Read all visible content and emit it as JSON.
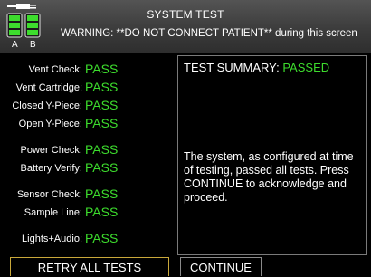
{
  "header": {
    "title": "SYSTEM TEST",
    "warning": "WARNING: **DO NOT CONNECT PATIENT** during this screen",
    "battery_a_label": "A",
    "battery_b_label": "B"
  },
  "checks": [
    {
      "label": "Vent Check:",
      "status": "PASS"
    },
    {
      "label": "Vent Cartridge:",
      "status": "PASS"
    },
    {
      "label": "Closed Y-Piece:",
      "status": "PASS"
    },
    {
      "label": "Open Y-Piece:",
      "status": "PASS"
    },
    {
      "label": "Power Check:",
      "status": "PASS"
    },
    {
      "label": "Battery Verify:",
      "status": "PASS"
    },
    {
      "label": "Sensor Check:",
      "status": "PASS"
    },
    {
      "label": "Sample Line:",
      "status": "PASS"
    },
    {
      "label": "Lights+Audio:",
      "status": "PASS"
    }
  ],
  "summary": {
    "title_prefix": "TEST SUMMARY:",
    "title_status": "PASSED",
    "message": "The system, as configured at time of testing, passed all tests. Press CONTINUE to acknowledge and proceed."
  },
  "buttons": {
    "retry": "RETRY ALL TESTS",
    "continue": "CONTINUE"
  },
  "colors": {
    "pass": "#3ddc2d",
    "retry_border": "#c9a83a"
  },
  "icons": {
    "power": "plug-battery-icon"
  }
}
